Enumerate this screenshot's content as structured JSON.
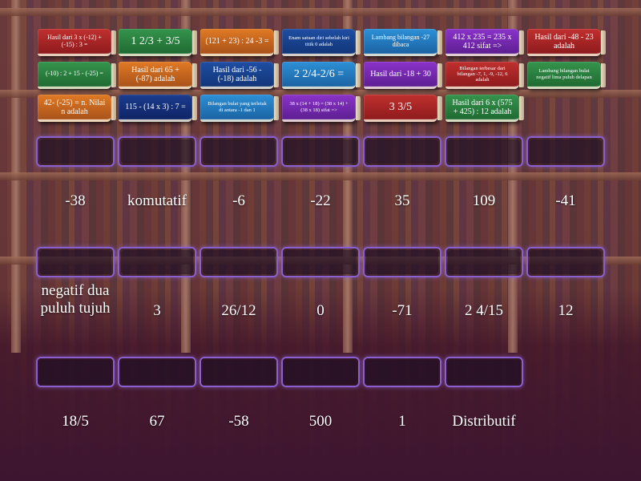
{
  "cards": [
    {
      "label": "Hasil dari 3 x (-12) + (-15) : 3 =",
      "color": "#c0302f"
    },
    {
      "label": "1 2/3 + 3/5",
      "color": "#35944d"
    },
    {
      "label": "(121 + 23) : 24 -3 =",
      "color": "#e07a24"
    },
    {
      "label": "Enam satuan diri sebelah kiri titik 0 adalah",
      "color": "#1f4ea3"
    },
    {
      "label": "Lambang bilangan -27 dibaca",
      "color": "#2d90d6"
    },
    {
      "label": "412 x 235 = 235 x 412 sifat =>",
      "color": "#8a33c9"
    },
    {
      "label": "Hasil dari -48 - 23 adalah",
      "color": "#c0302f"
    },
    {
      "label": "(-10) : 2 + 15 - (-25) =",
      "color": "#35944d"
    },
    {
      "label": "Hasil dari 65 + (-87) adalah",
      "color": "#e07a24"
    },
    {
      "label": "Hasil dari -56 - (-18) adalah",
      "color": "#1f4ea3"
    },
    {
      "label": "2 2/4-2/6 =",
      "color": "#2d90d6"
    },
    {
      "label": "Hasil dari -18 + 30",
      "color": "#8a33c9"
    },
    {
      "label": "Bilangan terbesar dari bilangan -7, 1, -9, -12, 6 adalah",
      "color": "#c0302f"
    },
    {
      "label": "Lambang bilangan bulat negatif lima puluh delapan",
      "color": "#35944d"
    },
    {
      "label": "42- (-25) = n. Nilai n adalah",
      "color": "#e07a24"
    },
    {
      "label": "115 - (14 x 3) : 7 =",
      "color": "#1b3c8e"
    },
    {
      "label": "Bilangan bulat yang terletak di antara -1 dan 1",
      "color": "#2d90d6"
    },
    {
      "label": "38 x (14 + 18) = (38 x 14) + (38 x 18) sifat =>",
      "color": "#8a33c9"
    },
    {
      "label": "3 3/5",
      "color": "#c0302f"
    },
    {
      "label": "Hasil dari 6 x (575 + 425) : 12 adalah",
      "color": "#35944d"
    }
  ],
  "answers_row1": [
    "-38",
    "komutatif",
    "-6",
    "-22",
    "35",
    "109",
    "-41"
  ],
  "answers_row2": [
    "negatif dua puluh tujuh",
    "3",
    "26/12",
    "0",
    "-71",
    "2 4/15",
    "12"
  ],
  "answers_row3": [
    "18/5",
    "67",
    "-58",
    "500",
    "1",
    "Distributif"
  ]
}
